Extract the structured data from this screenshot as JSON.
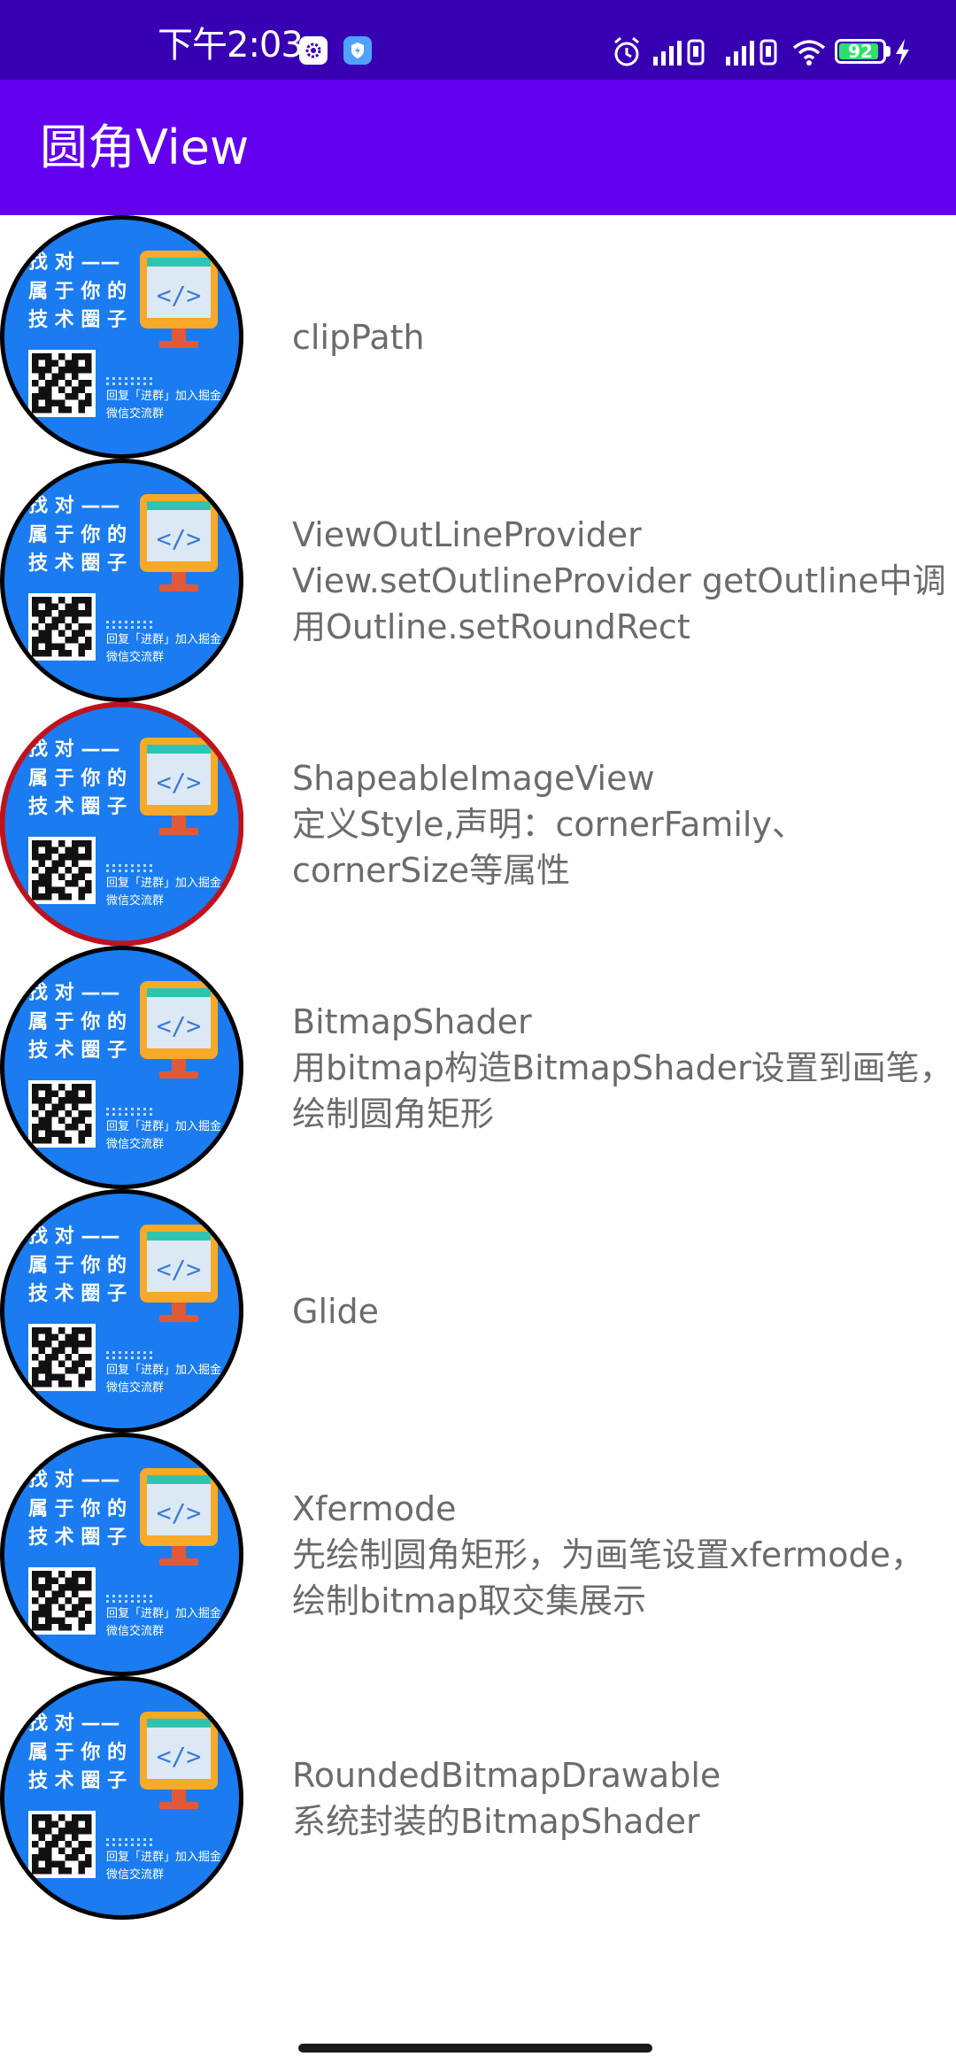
{
  "status_bar": {
    "time": "下午2:03",
    "battery": "92",
    "battery_level": 0.92,
    "icons": [
      "settings-badge-icon",
      "shield-badge-icon",
      "alarm-icon",
      "signal-1-icon",
      "signal-2-icon",
      "wifi-icon",
      "battery-icon",
      "charging-icon"
    ]
  },
  "app_bar": {
    "title": "圆角View"
  },
  "thumbnail": {
    "headline": [
      "找 对 ——",
      "属 于 你 的",
      "技 术 圈 子"
    ],
    "caption": [
      "回复「进群」加入掘金",
      "微信交流群"
    ],
    "colors": {
      "background": "#1a7cf0",
      "monitor": "#f7a928",
      "screen": "#dce9f5",
      "teal": "#2fc4b0"
    }
  },
  "items": [
    {
      "lines": [
        "clipPath"
      ],
      "border": "#000000"
    },
    {
      "lines": [
        "ViewOutLineProvider",
        "View.setOutlineProvider  getOutline中调",
        "用Outline.setRoundRect"
      ],
      "border": "#000000"
    },
    {
      "lines": [
        "ShapeableImageView",
        "定义Style,声明：cornerFamily、",
        "cornerSize等属性"
      ],
      "border": "#c0121c"
    },
    {
      "lines": [
        "BitmapShader",
        "用bitmap构造BitmapShader设置到画笔，",
        "绘制圆角矩形"
      ],
      "border": "#000000"
    },
    {
      "lines": [
        "Glide"
      ],
      "border": "#000000"
    },
    {
      "lines": [
        "Xfermode",
        "先绘制圆角矩形，为画笔设置xfermode，",
        "绘制bitmap取交集展示"
      ],
      "border": "#000000"
    },
    {
      "lines": [
        "RoundedBitmapDrawable",
        "系统封装的BitmapShader"
      ],
      "border": "#000000"
    }
  ]
}
